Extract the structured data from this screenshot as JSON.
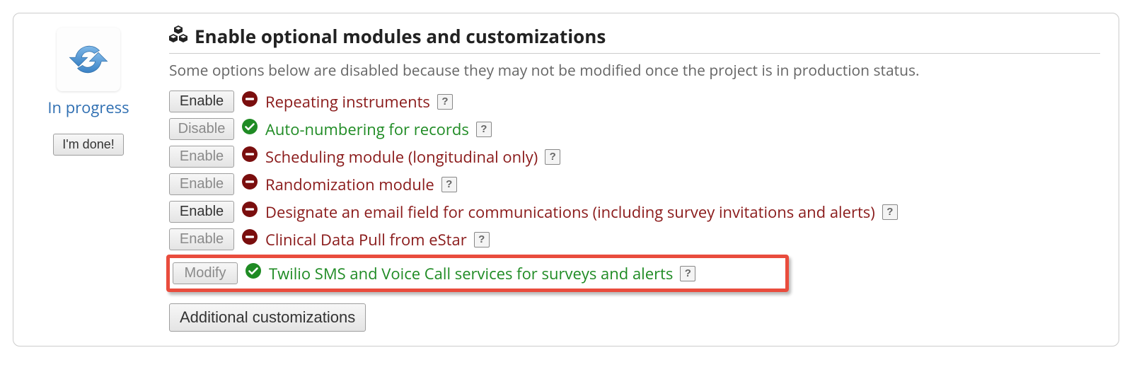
{
  "left": {
    "status": "In progress",
    "done_label": "I'm done!"
  },
  "heading": "Enable optional modules and customizations",
  "subtext": "Some options below are disabled because they may not be modified once the project is in production status.",
  "modules": [
    {
      "button": "Enable",
      "button_disabled": false,
      "enabled": false,
      "label": "Repeating instruments"
    },
    {
      "button": "Disable",
      "button_disabled": true,
      "enabled": true,
      "label": "Auto-numbering for records"
    },
    {
      "button": "Enable",
      "button_disabled": true,
      "enabled": false,
      "label": "Scheduling module (longitudinal only)"
    },
    {
      "button": "Enable",
      "button_disabled": true,
      "enabled": false,
      "label": "Randomization module"
    },
    {
      "button": "Enable",
      "button_disabled": false,
      "enabled": false,
      "label": "Designate an email field for communications (including survey invitations and alerts)"
    },
    {
      "button": "Enable",
      "button_disabled": true,
      "enabled": false,
      "label": "Clinical Data Pull from eStar"
    },
    {
      "button": "Modify",
      "button_disabled": true,
      "enabled": true,
      "label": "Twilio SMS and Voice Call services for surveys and alerts"
    }
  ],
  "help_label": "?",
  "additional_label": "Additional customizations"
}
